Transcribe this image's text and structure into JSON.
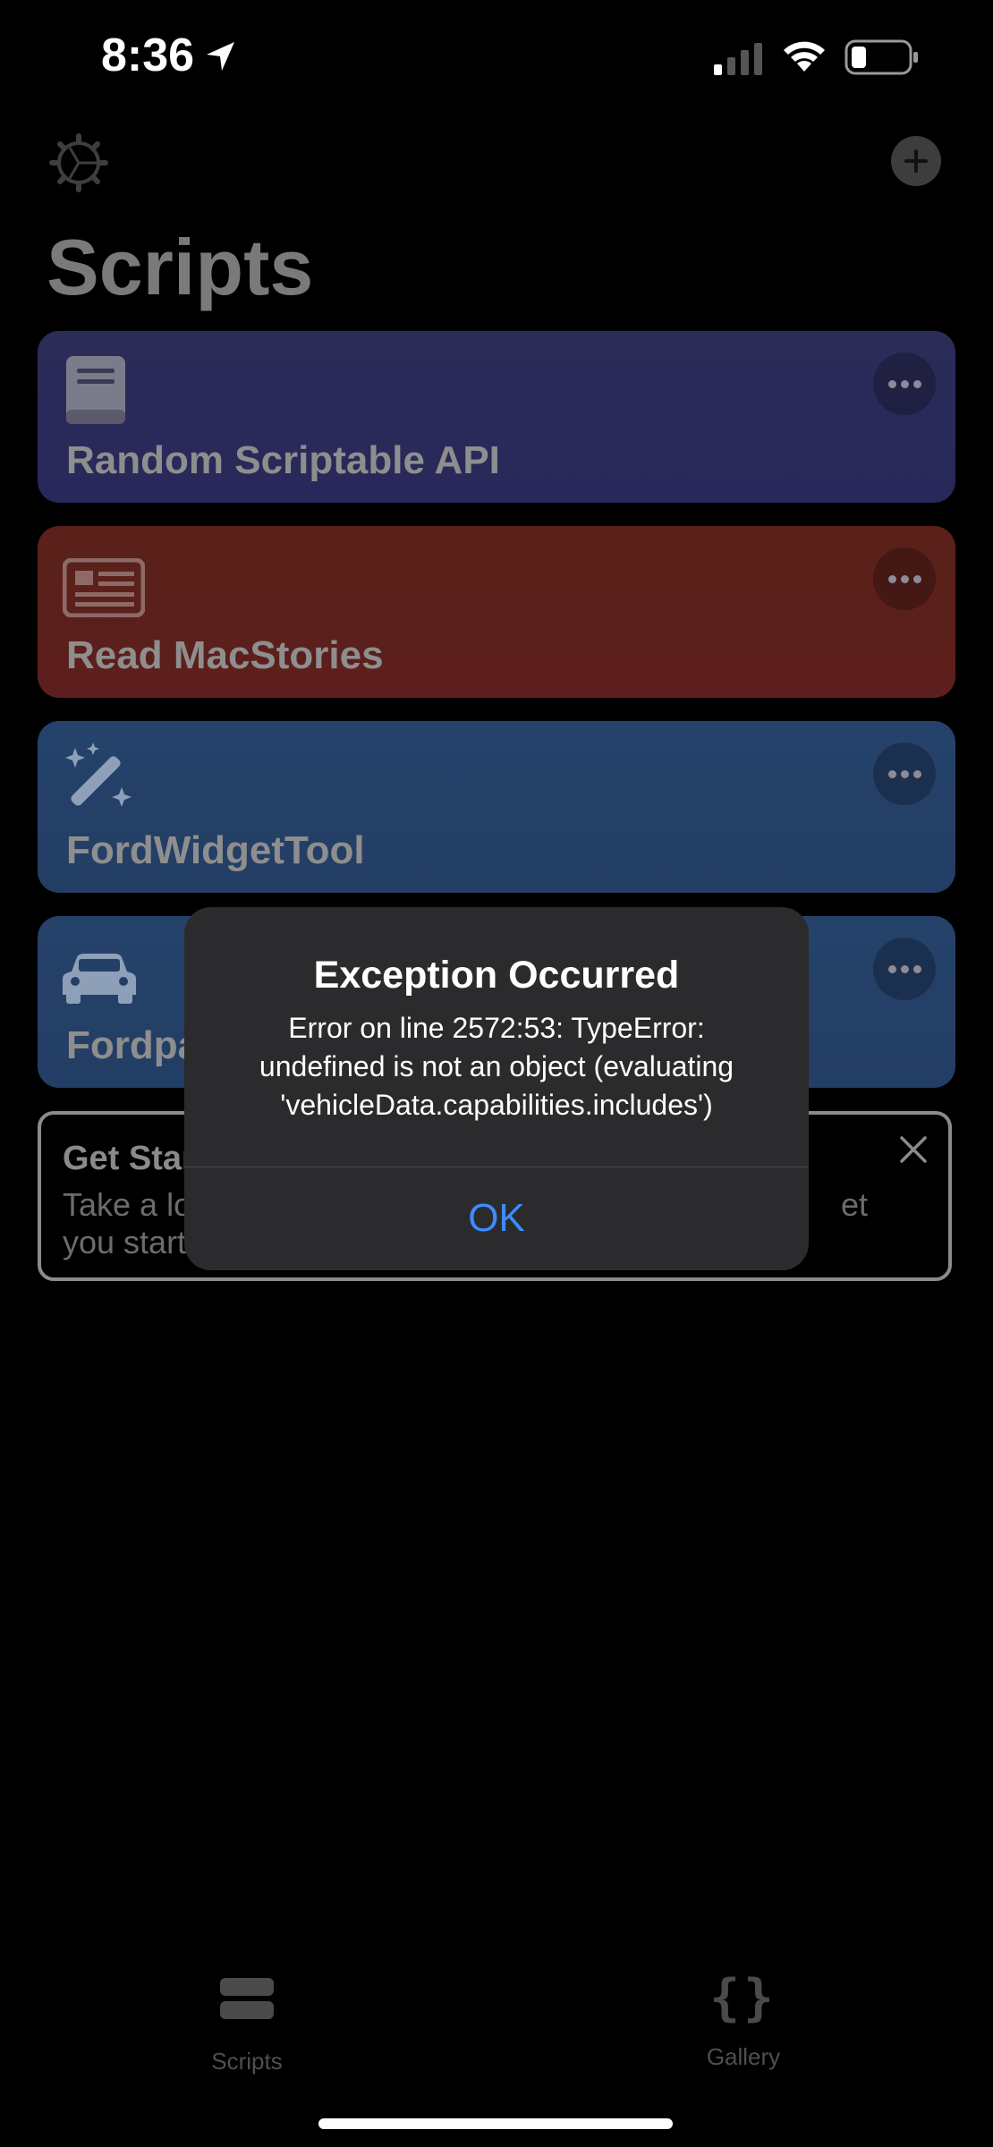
{
  "status_bar": {
    "time": "8:36"
  },
  "nav": {
    "title": "Scripts"
  },
  "scripts": [
    {
      "label": "Random Scriptable API",
      "icon": "book-icon",
      "color": "#2c2c59"
    },
    {
      "label": "Read MacStories",
      "icon": "newspaper-icon",
      "color": "#5a2019"
    },
    {
      "label": "FordWidgetTool",
      "icon": "magic-wand-icon",
      "color": "#25426b"
    },
    {
      "label": "Fordpa",
      "icon": "car-icon",
      "color": "#25426b"
    }
  ],
  "get_started": {
    "title": "Get Star",
    "text_line1_left": "Take a lo",
    "text_line1_right": "et",
    "text_line2": "you start"
  },
  "alert": {
    "title": "Exception Occurred",
    "message_line1": "Error on line 2572:53: TypeError:",
    "message_line2": "undefined is not an object (evaluating",
    "message_line3": "'vehicleData.capabilities.includes')",
    "ok_label": "OK",
    "accent_color": "#3d8bfd"
  },
  "tab_bar": {
    "scripts_label": "Scripts",
    "gallery_label": "Gallery",
    "gallery_icon_text": "{}"
  }
}
